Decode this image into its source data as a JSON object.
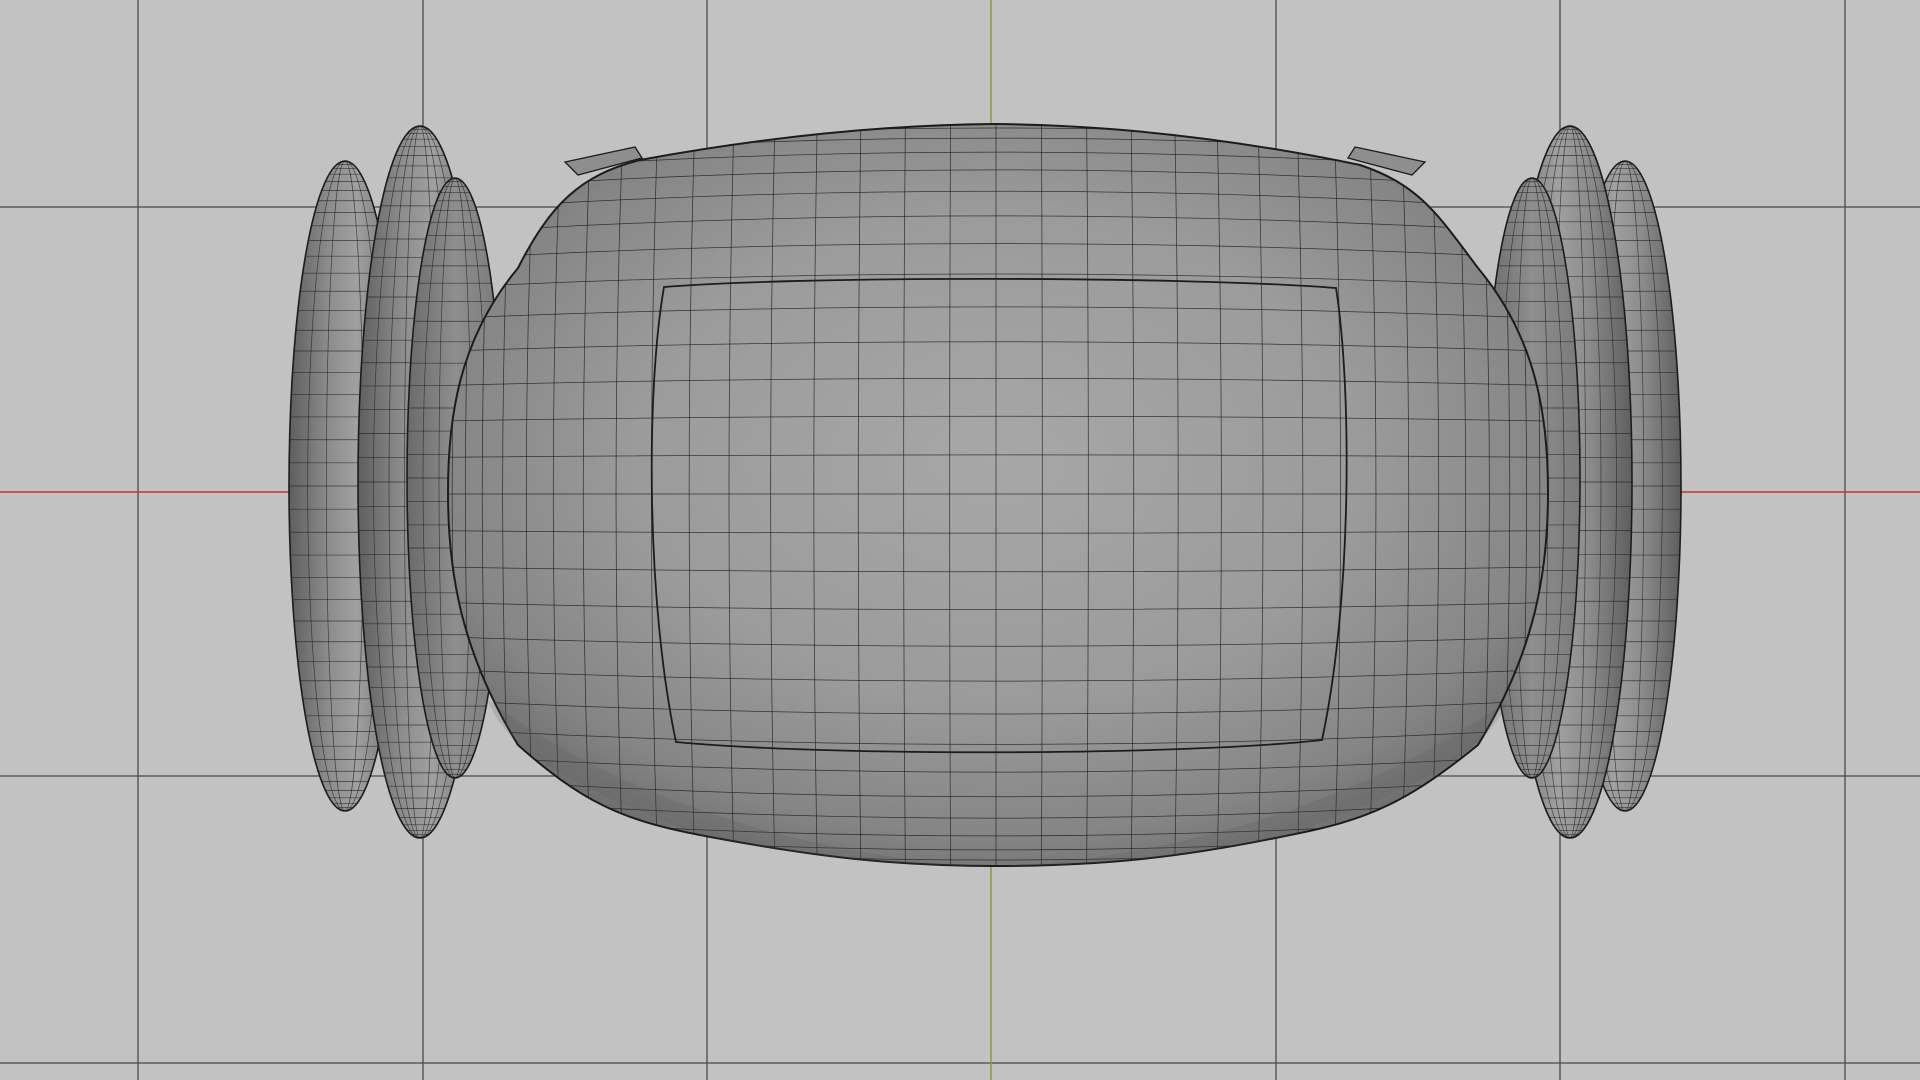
{
  "viewport": {
    "view": "3d-viewport-wireframe-on-shaded",
    "background_color": "#c2c2c2",
    "grid_color": "#4a4a4a",
    "x_axis_color": "#c0353d",
    "y_axis_color": "#7f9a36",
    "mesh_shade_light": "#a4a4a4",
    "mesh_shade_dark": "#5a5a5a",
    "wire_color": "#1c1c1c",
    "object_name": "barrel-with-rings-mesh"
  }
}
